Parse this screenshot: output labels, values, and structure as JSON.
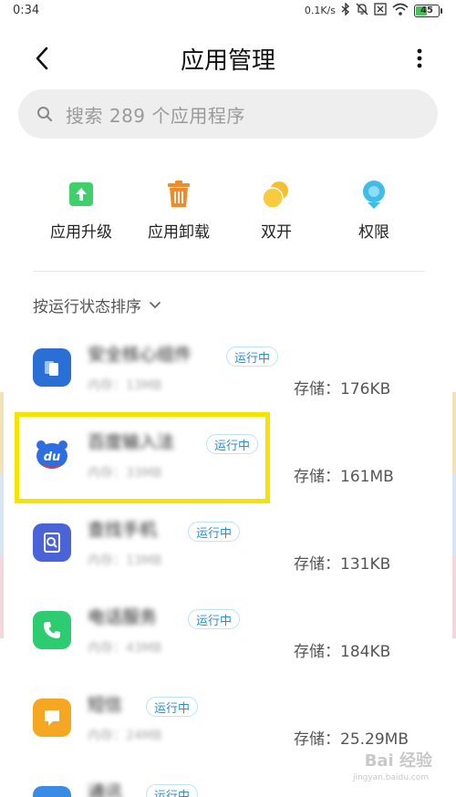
{
  "status_bar": {
    "time": "0:34",
    "net_speed": "0.1K/s",
    "battery": "45",
    "icons": [
      "bluetooth-icon",
      "mute-icon",
      "sim-off-icon",
      "wifi-icon",
      "battery-icon"
    ]
  },
  "header": {
    "title": "应用管理",
    "back_icon": "chevron-left-icon",
    "more_icon": "more-vertical-icon"
  },
  "search": {
    "placeholder": "搜索 289 个应用程序",
    "icon": "search-icon"
  },
  "quick_actions": [
    {
      "label": "应用升级",
      "icon": "upgrade-icon",
      "color": "#3fcf6b"
    },
    {
      "label": "应用卸载",
      "icon": "trash-icon",
      "color": "#f08a2a"
    },
    {
      "label": "双开",
      "icon": "dual-app-icon",
      "color": "#f5c030"
    },
    {
      "label": "权限",
      "icon": "permission-icon",
      "color": "#3fbce8"
    }
  ],
  "sort": {
    "label": "按运行状态排序",
    "icon": "chevron-down-icon"
  },
  "apps": [
    {
      "name": "安全核心组件",
      "badge": "运行中",
      "memory": "内存：13MB",
      "storage": "存储：176KB",
      "icon": "security-core-icon",
      "color": "#2a6fd6"
    },
    {
      "name": "百度输入法",
      "badge": "运行中",
      "memory": "内存：33MB",
      "storage": "存储：161MB",
      "icon": "baidu-ime-icon",
      "color": "#2d6fe0"
    },
    {
      "name": "查找手机",
      "badge": "运行中",
      "memory": "内存：13MB",
      "storage": "存储：131KB",
      "icon": "find-phone-icon",
      "color": "#4a63d8"
    },
    {
      "name": "电话服务",
      "badge": "运行中",
      "memory": "内存：43MB",
      "storage": "存储：184KB",
      "icon": "phone-icon",
      "color": "#2ecc71"
    },
    {
      "name": "短信",
      "badge": "运行中",
      "memory": "内存：24MB",
      "storage": "存储：25.29MB",
      "icon": "sms-icon",
      "color": "#f5a623"
    },
    {
      "name": "通讯",
      "badge": "运行中",
      "memory": "",
      "storage": "",
      "icon": "contacts-icon",
      "color": "#3a8be6"
    }
  ],
  "watermark": {
    "text": "Bai 经验",
    "sub": "jingyan.baidu.com"
  },
  "colors": {
    "highlight": "#f5e400",
    "badge_text": "#2a8fce"
  }
}
